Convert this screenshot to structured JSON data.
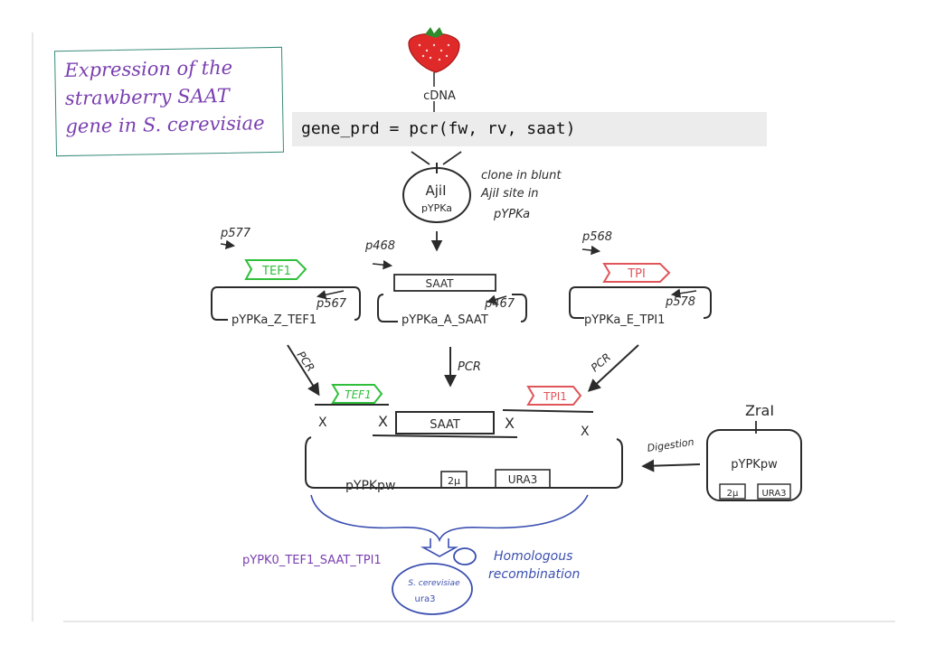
{
  "title": {
    "line1": "Expression of the",
    "line2": "strawberry SAAT",
    "line3": "gene in S. cerevisiae"
  },
  "code": "gene_prd = pcr(fw, rv, saat)",
  "labels": {
    "cdna": "cDNA",
    "clone_note_1": "clone in blunt",
    "clone_note_2": "AjiI site in",
    "clone_note_3": "pYPKa",
    "ajii": "AjiI",
    "pypka": "pYPKa",
    "p577": "p577",
    "p468": "p468",
    "p568": "p568",
    "p567": "p567",
    "p467": "p467",
    "p578": "p578",
    "tef1": "TEF1",
    "saat": "SAAT",
    "tpi": "TPI",
    "tpi1": "TPI1",
    "plasmid_left": "pYPKa_Z_TEF1",
    "plasmid_mid": "pYPKa_A_SAAT",
    "plasmid_right": "pYPKa_E_TPI1",
    "pcr": "PCR",
    "x": "X",
    "pypkpw": "pYPKpw",
    "two_mu": "2μ",
    "ura3": "URA3",
    "zrai": "ZraI",
    "digestion": "Digestion",
    "product": "pYPK0_TEF1_SAAT_TPI1",
    "homologous_1": "Homologous",
    "homologous_2": "recombination",
    "yeast_1": "S. cerevisiae",
    "yeast_2": "ura3"
  },
  "colors": {
    "ink": "#2b2b2b",
    "green": "#2fbf3a",
    "red": "#e0555a",
    "purple": "#7a3fb0",
    "blue": "#3b4fb0",
    "teal": "#3a8c7a"
  }
}
